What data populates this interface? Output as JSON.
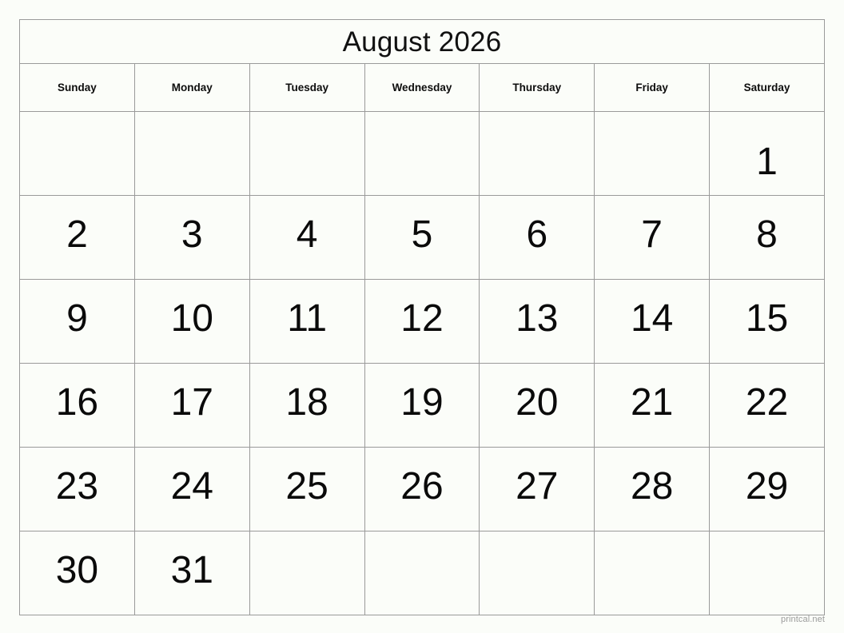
{
  "calendar": {
    "title": "August 2026",
    "month": "August",
    "year": "2026",
    "weekday_headers": [
      "Sunday",
      "Monday",
      "Tuesday",
      "Wednesday",
      "Thursday",
      "Friday",
      "Saturday"
    ],
    "week_start": "Sunday",
    "weeks": [
      [
        "",
        "",
        "",
        "",
        "",
        "",
        "1"
      ],
      [
        "2",
        "3",
        "4",
        "5",
        "6",
        "7",
        "8"
      ],
      [
        "9",
        "10",
        "11",
        "12",
        "13",
        "14",
        "15"
      ],
      [
        "16",
        "17",
        "18",
        "19",
        "20",
        "21",
        "22"
      ],
      [
        "23",
        "24",
        "25",
        "26",
        "27",
        "28",
        "29"
      ],
      [
        "30",
        "31",
        "",
        "",
        "",
        "",
        ""
      ]
    ],
    "days_in_month": "31",
    "first_day_weekday": "Saturday",
    "last_day_weekday": "Monday"
  },
  "watermark": {
    "text": "printcal.net"
  },
  "colors": {
    "page_background": "#fbfdf9",
    "cell_background": "#fbfdf9",
    "grid_line": "#9a9a9a",
    "text": "#0a0a0a",
    "watermark_text": "#9b9b9b"
  }
}
